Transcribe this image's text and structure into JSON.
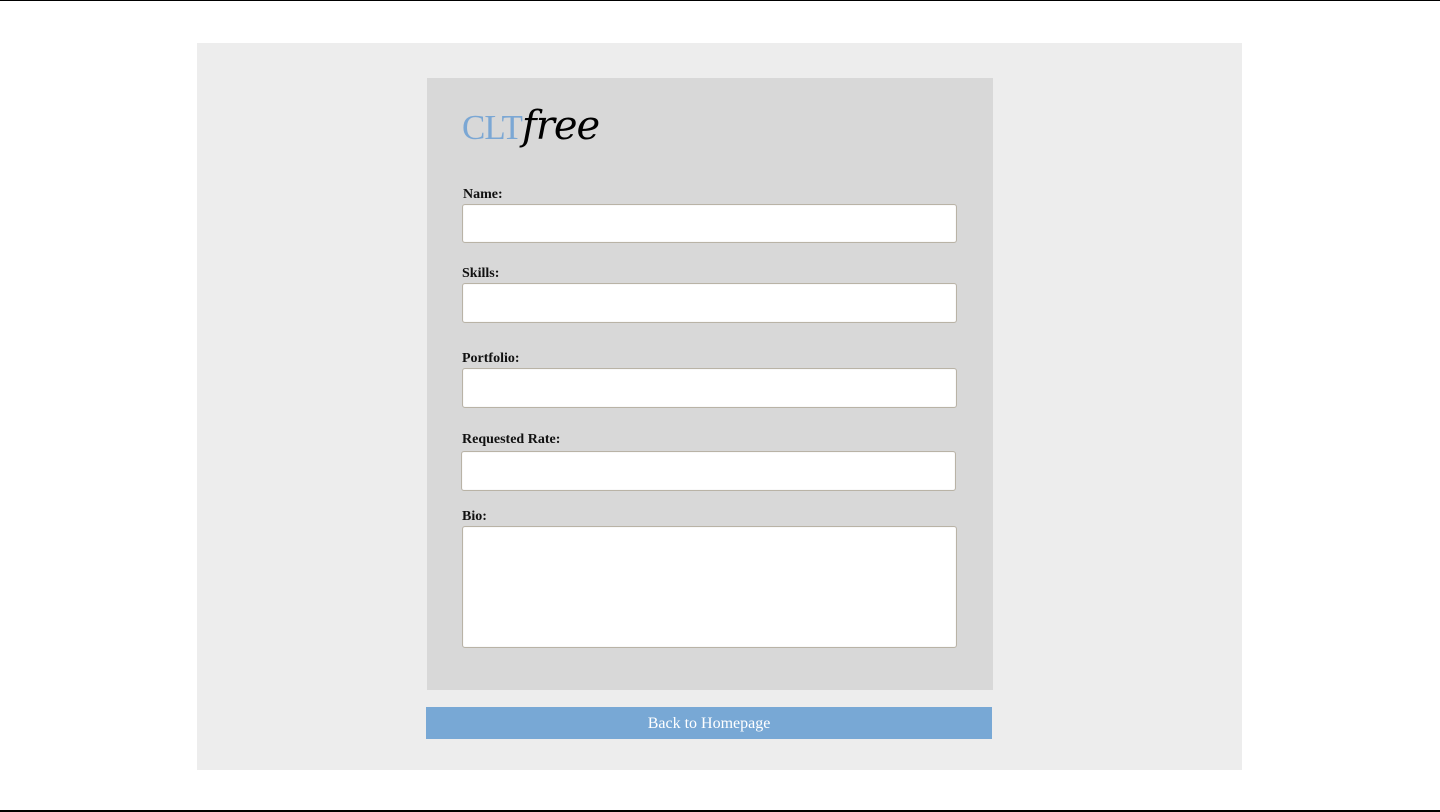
{
  "logo": {
    "part1": "CLT",
    "part2": "free",
    "part1_color": "#7ba7d4"
  },
  "form": {
    "name_label": "Name:",
    "name_value": "",
    "skills_label": "Skills:",
    "skills_value": "",
    "portfolio_label": "Portfolio:",
    "portfolio_value": "",
    "rate_label": "Requested Rate:",
    "rate_value": "",
    "bio_label": "Bio:",
    "bio_value": ""
  },
  "actions": {
    "back_label": "Back to Homepage",
    "back_color": "#78a8d5"
  },
  "colors": {
    "page_background": "#ffffff",
    "outer_panel": "#ededed",
    "form_card": "#d8d8d8"
  }
}
